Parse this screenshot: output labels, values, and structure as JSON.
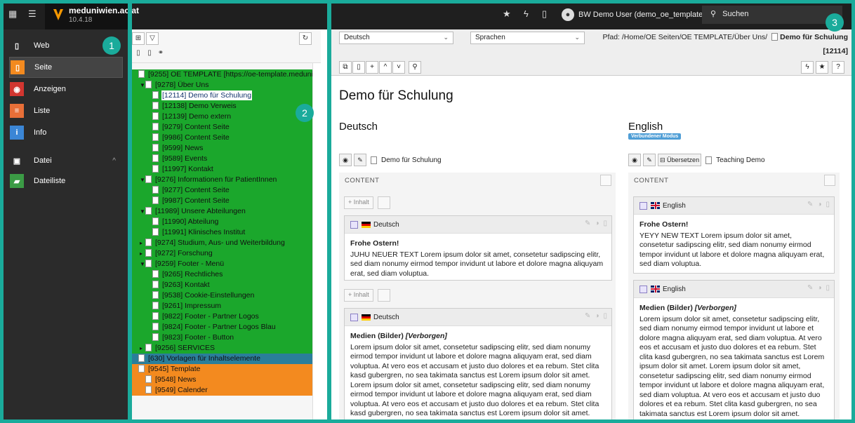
{
  "topbar": {
    "site_name": "meduniwien.ac.at",
    "version": "10.4.18",
    "user": "BW Demo User (demo_oe_template)",
    "search": "Suchen",
    "icons": [
      "apps-icon",
      "list-icon",
      "star-icon",
      "bolt-icon",
      "document-icon",
      "user-icon",
      "search-icon"
    ]
  },
  "modules": [
    {
      "label": "Web",
      "icon": "page-icon",
      "color": "#2b2b2b",
      "active": false
    },
    {
      "label": "Seite",
      "icon": "page-icon",
      "color": "#f38a1f",
      "active": true
    },
    {
      "label": "Anzeigen",
      "icon": "eye-icon",
      "color": "#d23630",
      "active": false
    },
    {
      "label": "Liste",
      "icon": "list-icon",
      "color": "#e86f38",
      "active": false
    },
    {
      "label": "Info",
      "icon": "info-icon",
      "color": "#3b86d6",
      "active": false
    },
    {
      "label": "Datei",
      "icon": "image-icon",
      "color": "#2b2b2b",
      "active": false
    },
    {
      "label": "Dateiliste",
      "icon": "folder-icon",
      "color": "#3b9b45",
      "active": false
    }
  ],
  "tree": [
    {
      "label": "[9255] OE TEMPLATE [https://oe-template.meduniwi",
      "indent": 0,
      "bg": "green",
      "exp": ""
    },
    {
      "label": "[9278] Über Uns",
      "indent": 1,
      "bg": "green",
      "exp": "▼"
    },
    {
      "label": "[12114] Demo für Schulung",
      "indent": 2,
      "bg": "green",
      "exp": "",
      "selected": true
    },
    {
      "label": "[12138] Demo Verweis",
      "indent": 2,
      "bg": "green",
      "exp": ""
    },
    {
      "label": "[12139] Demo extern",
      "indent": 2,
      "bg": "green",
      "exp": ""
    },
    {
      "label": "[9279] Content Seite",
      "indent": 2,
      "bg": "green",
      "exp": ""
    },
    {
      "label": "[9986] Content Seite",
      "indent": 2,
      "bg": "green",
      "exp": ""
    },
    {
      "label": "[9599] News",
      "indent": 2,
      "bg": "green",
      "exp": ""
    },
    {
      "label": "[9589] Events",
      "indent": 2,
      "bg": "green",
      "exp": ""
    },
    {
      "label": "[11997] Kontakt",
      "indent": 2,
      "bg": "green",
      "exp": ""
    },
    {
      "label": "[9276] Informationen für PatientInnen",
      "indent": 1,
      "bg": "green",
      "exp": "▼"
    },
    {
      "label": "[9277] Content Seite",
      "indent": 2,
      "bg": "green",
      "exp": ""
    },
    {
      "label": "[9987] Content Seite",
      "indent": 2,
      "bg": "green",
      "exp": ""
    },
    {
      "label": "[11989] Unsere Abteilungen",
      "indent": 1,
      "bg": "green",
      "exp": "▼"
    },
    {
      "label": "[11990] Abteilung",
      "indent": 2,
      "bg": "green",
      "exp": ""
    },
    {
      "label": "[11991] Klinisches Institut",
      "indent": 2,
      "bg": "green",
      "exp": ""
    },
    {
      "label": "[9274] Studium, Aus- und Weiterbildung",
      "indent": 1,
      "bg": "green",
      "exp": "▸"
    },
    {
      "label": "[9272] Forschung",
      "indent": 1,
      "bg": "green",
      "exp": "▸"
    },
    {
      "label": "[9259] Footer - Menü",
      "indent": 1,
      "bg": "green",
      "exp": "▼"
    },
    {
      "label": "[9265] Rechtliches",
      "indent": 2,
      "bg": "green",
      "exp": ""
    },
    {
      "label": "[9263] Kontakt",
      "indent": 2,
      "bg": "green",
      "exp": ""
    },
    {
      "label": "[9538] Cookie-Einstellungen",
      "indent": 2,
      "bg": "green",
      "exp": ""
    },
    {
      "label": "[9261] Impressum",
      "indent": 2,
      "bg": "green",
      "exp": ""
    },
    {
      "label": "[9822] Footer - Partner Logos",
      "indent": 2,
      "bg": "green",
      "exp": ""
    },
    {
      "label": "[9824] Footer - Partner Logos Blau",
      "indent": 2,
      "bg": "green",
      "exp": ""
    },
    {
      "label": "[9823] Footer - Button",
      "indent": 2,
      "bg": "green",
      "exp": ""
    },
    {
      "label": "[9256] SERVICES",
      "indent": 1,
      "bg": "green",
      "exp": "▸"
    },
    {
      "label": "[630] Vorlagen für Inhaltselemente",
      "indent": 0,
      "bg": "blue",
      "exp": ""
    },
    {
      "label": "[9545] Template",
      "indent": 0,
      "bg": "orange",
      "exp": ""
    },
    {
      "label": "[9548] News",
      "indent": 1,
      "bg": "orange",
      "exp": ""
    },
    {
      "label": "[9549] Calender",
      "indent": 1,
      "bg": "orange",
      "exp": ""
    }
  ],
  "docheader": {
    "lang_select": "Deutsch",
    "view_select": "Sprachen",
    "path_prefix": "Pfad: /Home/OE Seiten/OE TEMPLATE/Über Uns/",
    "path_current": "Demo für Schulung",
    "uid": "[12114]"
  },
  "main": {
    "title": "Demo für Schulung",
    "col_de": {
      "title": "Deutsch",
      "page_label": "Demo für Schulung",
      "section": "CONTENT",
      "add_label": "+ Inhalt",
      "cards": [
        {
          "lang": "Deutsch",
          "heading": "Frohe Ostern!",
          "heading_extra": "",
          "text": "JUHU NEUER TEXT Lorem ipsum dolor sit amet, consetetur sadipscing elitr, sed diam nonumy eirmod tempor invidunt ut labore et dolore magna aliquyam erat, sed diam voluptua."
        },
        {
          "lang": "Deutsch",
          "heading": "Medien (Bilder)",
          "heading_extra": "[Verborgen]",
          "text": "Lorem ipsum dolor sit amet, consetetur sadipscing elitr, sed diam nonumy eirmod tempor invidunt ut labore et dolore magna aliquyam erat, sed diam voluptua. At vero eos et accusam et justo duo dolores et ea rebum. Stet clita kasd gubergren, no sea takimata sanctus est Lorem ipsum dolor sit amet. Lorem ipsum dolor sit amet, consetetur sadipscing elitr, sed diam nonumy eirmod tempor invidunt ut labore et dolore magna aliquyam erat, sed diam voluptua. At vero eos et accusam et justo duo dolores et ea rebum. Stet clita kasd gubergren, no sea takimata sanctus est Lorem ipsum dolor sit amet."
        }
      ]
    },
    "col_en": {
      "title": "English",
      "badge": "Verbundener Modus",
      "translate_label": "Übersetzen",
      "page_label": "Teaching Demo",
      "section": "CONTENT",
      "cards": [
        {
          "lang": "English",
          "heading": "Frohe Ostern!",
          "heading_extra": "",
          "text": "YEYY NEW TEXT Lorem ipsum dolor sit amet, consetetur sadipscing elitr, sed diam nonumy eirmod tempor invidunt ut labore et dolore magna aliquyam erat, sed diam voluptua."
        },
        {
          "lang": "English",
          "heading": "Medien (Bilder)",
          "heading_extra": "[Verborgen]",
          "text": "Lorem ipsum dolor sit amet, consetetur sadipscing elitr, sed diam nonumy eirmod tempor invidunt ut labore et dolore magna aliquyam erat, sed diam voluptua. At vero eos et accusam et justo duo dolores et ea rebum. Stet clita kasd gubergren, no sea takimata sanctus est Lorem ipsum dolor sit amet. Lorem ipsum dolor sit amet, consetetur sadipscing elitr, sed diam nonumy eirmod tempor invidunt ut labore et dolore magna aliquyam erat, sed diam voluptua. At vero eos et accusam et justo duo dolores et ea rebum. Stet clita kasd gubergren, no sea takimata sanctus est Lorem ipsum dolor sit amet."
        }
      ]
    }
  },
  "annotations": {
    "one": "1",
    "two": "2",
    "three": "3"
  },
  "colors": {
    "frame": "#1aab9b",
    "tree_green": "#1ba72c",
    "tree_orange": "#f38a1f",
    "tree_blue": "#2a7e9a"
  }
}
